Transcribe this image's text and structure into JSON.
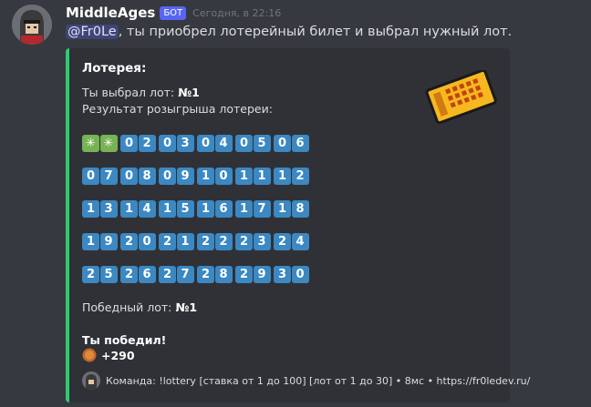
{
  "message": {
    "username": "MiddleAges",
    "badge": "БОТ",
    "timestamp": "Сегодня, в 22:16",
    "mention": "@Fr0Le",
    "text": ", ты приобрел лотерейный билет и выбрал нужный лот."
  },
  "embed": {
    "accent_color": "#2ecc71",
    "title": "Лотерея:",
    "picked_label": "Ты выбрал лот: ",
    "picked_value": "№1",
    "result_label": "Результат розыгрыша лотереи:",
    "rows": [
      [
        "✳",
        "02",
        "03",
        "04",
        "05",
        "06"
      ],
      [
        "07",
        "08",
        "09",
        "10",
        "11",
        "12"
      ],
      [
        "13",
        "14",
        "15",
        "16",
        "17",
        "18"
      ],
      [
        "19",
        "20",
        "21",
        "22",
        "23",
        "24"
      ],
      [
        "25",
        "26",
        "27",
        "28",
        "29",
        "30"
      ]
    ],
    "winning_label": "Победный лот: ",
    "winning_value": "№1",
    "win_title": "Ты победил!",
    "prize": "+290",
    "footer": "Команда: !lottery [ставка от 1 до 100] [лот от 1 до 30] • 8мс • https://fr0ledev.ru/"
  },
  "icons": {
    "avatar": "knight-avatar",
    "thumbnail": "ticket-icon",
    "coin": "coin-icon",
    "footer": "footer-avatar"
  },
  "colors": {
    "background": "#36393f",
    "embed_bg": "#2f3136",
    "tile_blue": "#3b88c3",
    "tile_green": "#77b255",
    "badge": "#5865f2"
  }
}
